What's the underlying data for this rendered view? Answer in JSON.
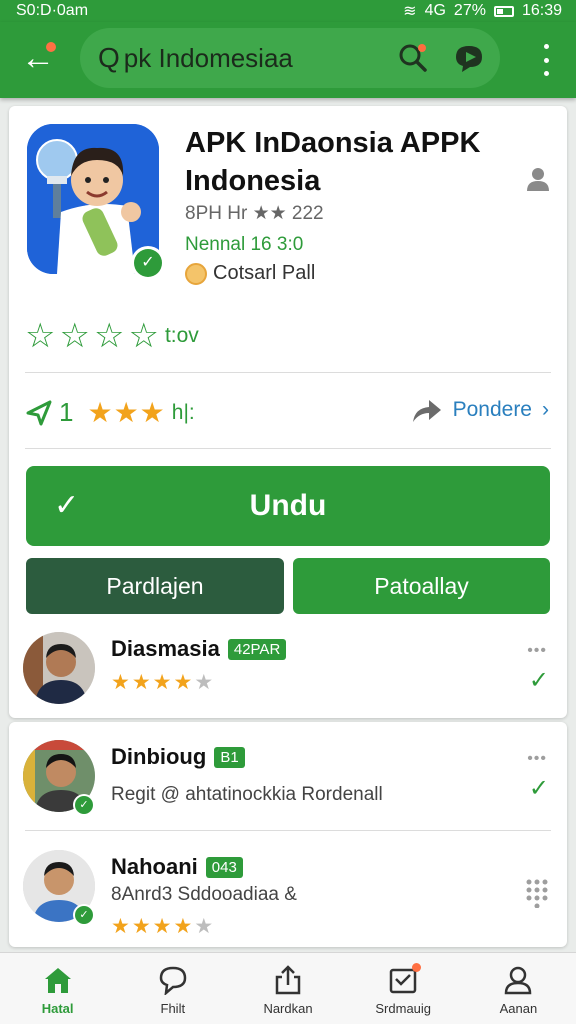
{
  "status_bar": {
    "left_text": "S0:D·0am",
    "signal": "4G",
    "battery": "27%",
    "time": "16:39"
  },
  "search": {
    "value": "pk Indomesiaa"
  },
  "app": {
    "title": "APK InDaonsia APPK Indonesia",
    "meta_line1": "8PH Hr ★★ 222",
    "meta_line2": "Nennal 16 3:0",
    "meta_line3": "Cotsarl Pall",
    "outline_rating_label": "t:ov",
    "stat_number": "1",
    "stat_label": "h|:",
    "share_label": "Pondere",
    "rating_stars": 3
  },
  "buttons": {
    "primary": "Undu",
    "secondary_left": "Pardlajen",
    "secondary_right": "Patoallay"
  },
  "reviews": [
    {
      "name": "Diasmasia",
      "tag": "42PAR",
      "stars": 4,
      "text": "",
      "dots": "•••"
    },
    {
      "name": "Dinbioug",
      "tag": "B1",
      "stars": 0,
      "text": "Regit @ ahtatinockkia Rordenall",
      "dots": "•••"
    },
    {
      "name": "Nahoani",
      "tag": "043",
      "stars": 4,
      "text": "8Anrd3 Sddooadiaa &",
      "dots": ""
    }
  ],
  "bottom_nav": [
    {
      "label": "Hatal",
      "icon": "home-icon",
      "active": true
    },
    {
      "label": "Fhilt",
      "icon": "chat-bubble-icon",
      "active": false
    },
    {
      "label": "Nardkan",
      "icon": "share-upload-icon",
      "active": false
    },
    {
      "label": "Srdmauig",
      "icon": "inbox-icon",
      "active": false
    },
    {
      "label": "Aanan",
      "icon": "person-icon",
      "active": false
    }
  ],
  "colors": {
    "primary": "#2e9b3a",
    "dark_button": "#2c5c3e",
    "star": "#f2a31c",
    "link": "#2a7fbe"
  }
}
